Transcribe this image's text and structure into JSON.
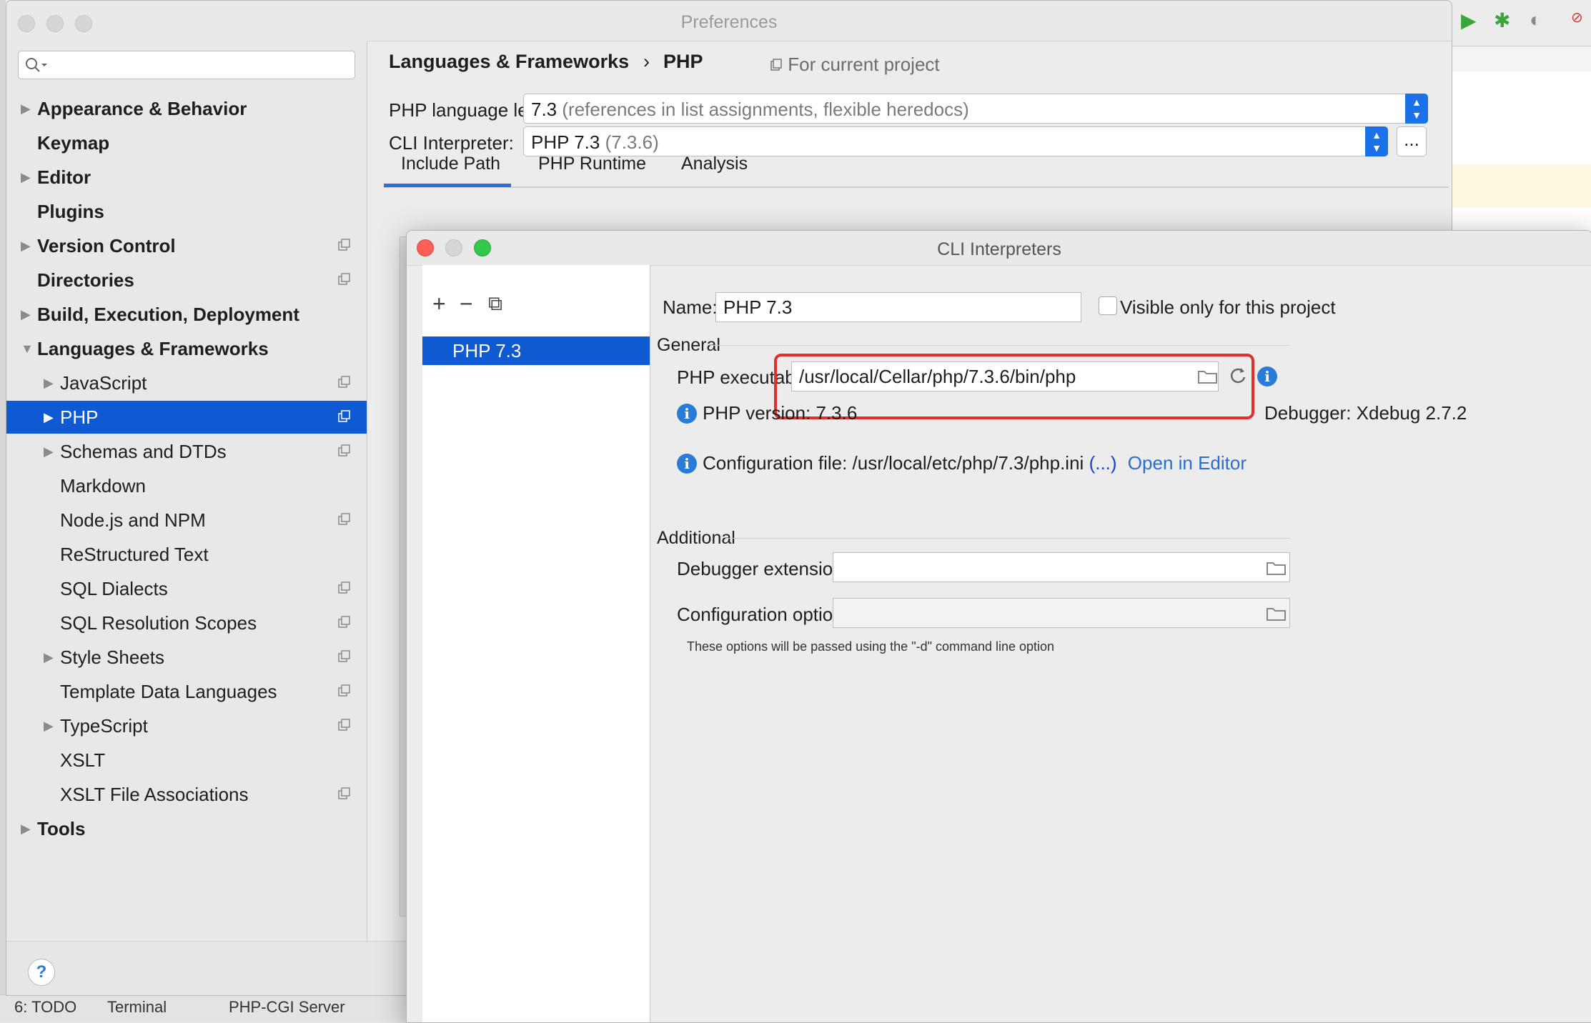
{
  "preferences": {
    "title": "Preferences",
    "search": {
      "placeholder": ""
    },
    "tree": [
      {
        "label": "Appearance & Behavior",
        "level": 0,
        "expandable": true,
        "expanded": false,
        "project": false
      },
      {
        "label": "Keymap",
        "level": 0,
        "expandable": false,
        "project": false
      },
      {
        "label": "Editor",
        "level": 0,
        "expandable": true,
        "expanded": false,
        "project": false
      },
      {
        "label": "Plugins",
        "level": 0,
        "expandable": false,
        "project": false
      },
      {
        "label": "Version Control",
        "level": 0,
        "expandable": true,
        "expanded": false,
        "project": true
      },
      {
        "label": "Directories",
        "level": 0,
        "expandable": false,
        "project": true
      },
      {
        "label": "Build, Execution, Deployment",
        "level": 0,
        "expandable": true,
        "expanded": false,
        "project": false
      },
      {
        "label": "Languages & Frameworks",
        "level": 0,
        "expandable": true,
        "expanded": true,
        "project": false
      },
      {
        "label": "JavaScript",
        "level": 1,
        "expandable": true,
        "expanded": false,
        "project": true
      },
      {
        "label": "PHP",
        "level": 1,
        "expandable": true,
        "expanded": false,
        "project": true,
        "selected": true
      },
      {
        "label": "Schemas and DTDs",
        "level": 1,
        "expandable": true,
        "expanded": false,
        "project": true
      },
      {
        "label": "Markdown",
        "level": 1,
        "expandable": false,
        "project": false
      },
      {
        "label": "Node.js and NPM",
        "level": 1,
        "expandable": false,
        "project": true
      },
      {
        "label": "ReStructured Text",
        "level": 1,
        "expandable": false,
        "project": false
      },
      {
        "label": "SQL Dialects",
        "level": 1,
        "expandable": false,
        "project": true
      },
      {
        "label": "SQL Resolution Scopes",
        "level": 1,
        "expandable": false,
        "project": true
      },
      {
        "label": "Style Sheets",
        "level": 1,
        "expandable": true,
        "expanded": false,
        "project": true
      },
      {
        "label": "Template Data Languages",
        "level": 1,
        "expandable": false,
        "project": true
      },
      {
        "label": "TypeScript",
        "level": 1,
        "expandable": true,
        "expanded": false,
        "project": true
      },
      {
        "label": "XSLT",
        "level": 1,
        "expandable": false,
        "project": false
      },
      {
        "label": "XSLT File Associations",
        "level": 1,
        "expandable": false,
        "project": true
      },
      {
        "label": "Tools",
        "level": 0,
        "expandable": true,
        "expanded": false,
        "project": false
      }
    ],
    "breadcrumb": {
      "parent": "Languages & Frameworks",
      "sep": "›",
      "current": "PHP"
    },
    "for_current_project": "For current project",
    "language_level": {
      "label": "PHP language level:",
      "value": "7.3",
      "hint": "(references in list assignments, flexible heredocs)"
    },
    "cli_interpreter": {
      "label": "CLI Interpreter:",
      "value": "PHP 7.3",
      "hint": "(7.3.6)",
      "more": "..."
    },
    "tabs": [
      "Include Path",
      "PHP Runtime",
      "Analysis"
    ],
    "help": "?"
  },
  "cli_dialog": {
    "title": "CLI Interpreters",
    "toolbar": {
      "add": "+",
      "remove": "−",
      "copy": "⧉"
    },
    "interpreters": [
      "PHP 7.3"
    ],
    "name": {
      "label": "Name:",
      "value": "PHP 7.3"
    },
    "visible_only": {
      "label": "Visible only for this project",
      "checked": false
    },
    "general": {
      "title": "General",
      "executable_label": "PHP executable",
      "executable_value": "/usr/local/Cellar/php/7.3.6/bin/php",
      "php_version": "PHP version: 7.3.6",
      "debugger": "Debugger: Xdebug 2.7.2",
      "config_file": "Configuration file: /usr/local/etc/php/7.3/php.ini",
      "config_more": "(...)",
      "open_in_editor": "Open in Editor"
    },
    "additional": {
      "title": "Additional",
      "debugger_ext_label": "Debugger extension:",
      "debugger_ext_value": "",
      "config_options_label": "Configuration options:",
      "config_options_value": "",
      "hint": "These options will be passed using the \"-d\" command line option"
    }
  },
  "ide_bottom": {
    "todo": "6: TODO",
    "terminal": "Terminal",
    "php_server": "PHP-CGI Server"
  },
  "colors": {
    "selection": "#0f59d3",
    "accent": "#1b72e8",
    "link": "#2a6ecb",
    "highlight_box": "#e0302a"
  }
}
